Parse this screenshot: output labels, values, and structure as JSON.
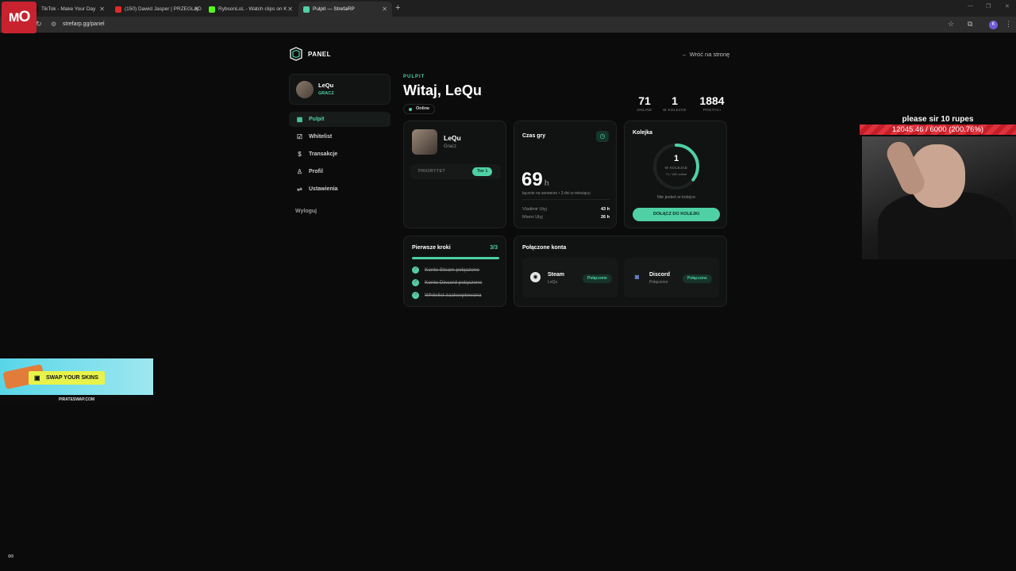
{
  "browser": {
    "tabs": [
      {
        "title": "TikTok - Make Your Day",
        "fav": "#111111"
      },
      {
        "title": "(150) Dawid Jasper | PRZEGLĄD",
        "fav": "#e02a2a"
      },
      {
        "title": "RybsonLoL - Watch clips on K",
        "fav": "#53fc18"
      },
      {
        "title": "Pulpit — StrefaRP",
        "fav": "#4fd1a5"
      }
    ],
    "url": "strefarp.gg/panel",
    "profile_initial": "K"
  },
  "header": {
    "panel_label": "PANEL",
    "back_link": "← Wróć na stronę"
  },
  "user": {
    "name": "LeQu",
    "role": "GRACZ"
  },
  "sidebar": {
    "items": [
      {
        "label": "Pulpit"
      },
      {
        "label": "Whitelist"
      },
      {
        "label": "Transakcje"
      },
      {
        "label": "Profil"
      },
      {
        "label": "Ustawienia"
      }
    ],
    "logout": "Wyloguj"
  },
  "main": {
    "kicker": "PULPIT",
    "greeting": "Witaj, LeQu",
    "status": "Online",
    "stats": [
      {
        "value": "71",
        "label": "ONLINE"
      },
      {
        "value": "1",
        "label": "W KOLEJCE"
      },
      {
        "value": "1884",
        "label": "POSTACI"
      }
    ]
  },
  "profile_card": {
    "name": "LeQu",
    "role": "Gracz",
    "priority_label": "PRIORYTET",
    "priority_value": "Tier 1"
  },
  "playtime_card": {
    "title": "Czas gry",
    "hours": "69",
    "unit": "h",
    "subtitle": "łącznie na serwerze • 3 dni w miesiącu",
    "rows": [
      {
        "label": "Vladimir Utyj",
        "value": "43 h"
      },
      {
        "label": "Miami Utyj",
        "value": "26 h"
      }
    ]
  },
  "queue_card": {
    "title": "Kolejka",
    "count": "1",
    "count_label": "W KOLEJCE",
    "count_sub": "71 / 200 online",
    "progress": 0.355,
    "status": "Nie jesteś w kolejce",
    "button": "DOŁĄCZ DO KOLEJKI"
  },
  "first_steps": {
    "title": "Pierwsze kroki",
    "count": "3/3",
    "progress": 1.0,
    "items": [
      {
        "label": "Konto Steam połączone"
      },
      {
        "label": "Konto Discord połączone"
      },
      {
        "label": "Whitelist zaakceptowana"
      }
    ]
  },
  "connected": {
    "title": "Połączone konta",
    "accounts": [
      {
        "name": "Steam",
        "sub": "LeQu",
        "status": "Połączone"
      },
      {
        "name": "Discord",
        "sub": "Połączono",
        "status": "Połączone"
      }
    ]
  },
  "overlay": {
    "logo_text": "ᴍO",
    "donation_text": "please sir 10 rupes",
    "donation_progress": "12045.46 / 6000 (200.76%)",
    "ad_button": "SWAP YOUR SKINS",
    "ad_url": "PIRATESWAP.COM"
  },
  "colors": {
    "accent": "#4fd1a5",
    "background": "#0b0b0b",
    "card": "#111312"
  }
}
